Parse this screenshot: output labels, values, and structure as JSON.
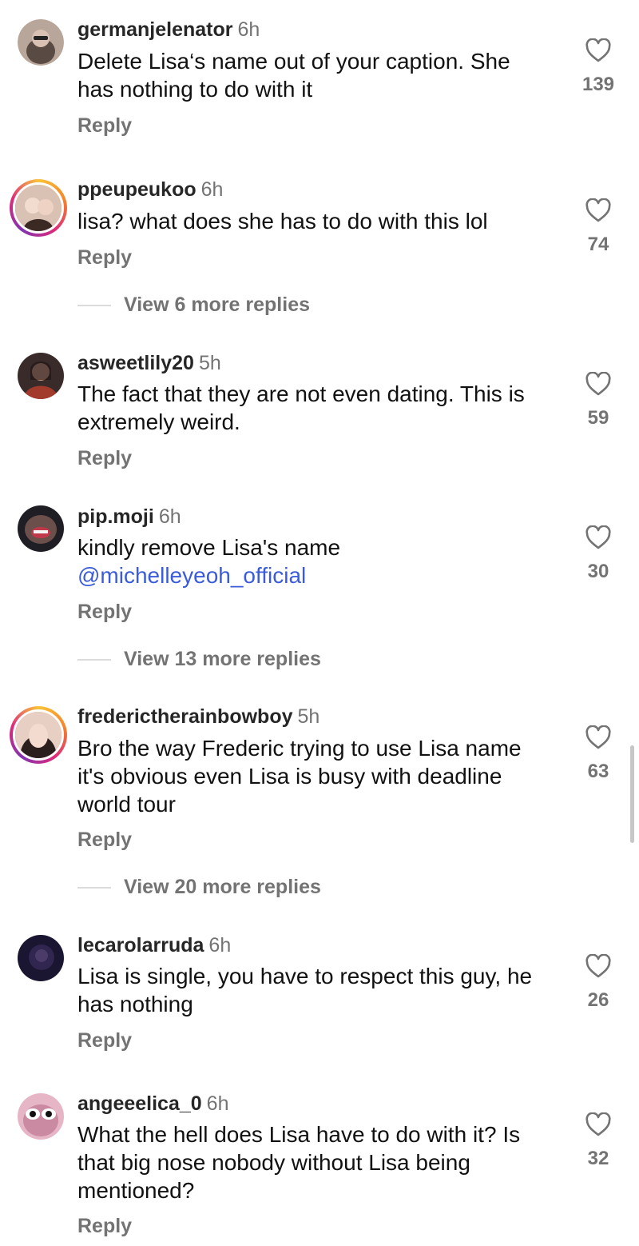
{
  "comments": [
    {
      "user": "germanjelenator",
      "time": "6h",
      "text_lines": [
        "Delete Lisa‘s name out of your caption. She",
        "has nothing to do with it"
      ],
      "likes": "139",
      "reply": "Reply",
      "avatar_style": "plain",
      "avatar_colors": [
        "#b8a69a",
        "#5a4a44"
      ]
    },
    {
      "user": "ppeupeukoo",
      "time": "6h",
      "text_lines": [
        "lisa? what does she has to do with this lol"
      ],
      "likes": "74",
      "reply": "Reply",
      "avatar_style": "ring",
      "avatar_colors": [
        "#d9c2b4",
        "#3b2a24"
      ],
      "view_more": "View 6 more replies"
    },
    {
      "user": "asweetlily20",
      "time": "5h",
      "text_lines": [
        "The fact that they are not even dating. This is",
        "extremely weird."
      ],
      "likes": "59",
      "reply": "Reply",
      "avatar_style": "plain",
      "avatar_colors": [
        "#3a2b2b",
        "#a33b2c"
      ]
    },
    {
      "user": "pip.moji",
      "time": "6h",
      "text_lines": [
        "kindly remove Lisa's name"
      ],
      "mention": "@michelleyeoh_official",
      "likes": "30",
      "reply": "Reply",
      "avatar_style": "plain",
      "avatar_colors": [
        "#1e1e24",
        "#c0394b"
      ],
      "view_more": "View 13 more replies"
    },
    {
      "user": "frederictherainbowboy",
      "time": "5h",
      "text_lines": [
        "Bro the way Frederic trying to use Lisa name",
        "it's obvious even Lisa is busy with deadline",
        "world tour"
      ],
      "likes": "63",
      "reply": "Reply",
      "avatar_style": "ring",
      "avatar_colors": [
        "#e8cfc4",
        "#2a1f1c"
      ],
      "view_more": "View 20 more replies"
    },
    {
      "user": "lecarolarruda",
      "time": "6h",
      "text_lines": [
        "Lisa is single, you have to respect this guy, he",
        "has nothing"
      ],
      "likes": "26",
      "reply": "Reply",
      "avatar_style": "plain",
      "avatar_colors": [
        "#1a1530",
        "#3b2d5c"
      ]
    },
    {
      "user": "angeeelica_0",
      "time": "6h",
      "text_lines": [
        "What the hell does Lisa have to do with it? Is",
        "that big nose nobody without Lisa being",
        "mentioned?"
      ],
      "likes": "32",
      "reply": "Reply",
      "avatar_style": "plain",
      "avatar_colors": [
        "#e7b6c6",
        "#ffffff"
      ]
    }
  ]
}
